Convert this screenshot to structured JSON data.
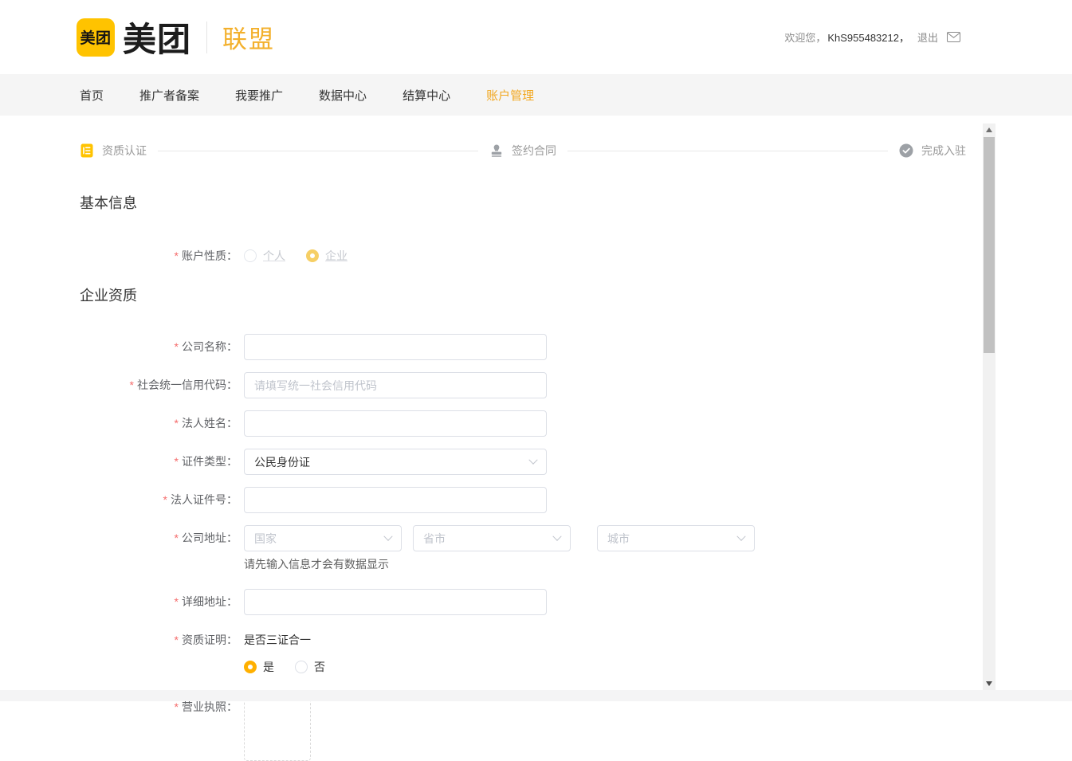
{
  "header": {
    "logo_badge": "美团",
    "logo_wordmark": "美团",
    "brand_suffix": "联盟",
    "welcome_prefix": "欢迎您，",
    "username": "KhS955483212，",
    "logout": "退出"
  },
  "nav": {
    "items": [
      {
        "label": "首页"
      },
      {
        "label": "推广者备案"
      },
      {
        "label": "我要推广"
      },
      {
        "label": "数据中心"
      },
      {
        "label": "结算中心"
      },
      {
        "label": "账户管理"
      }
    ],
    "active": "账户管理"
  },
  "stepper": {
    "steps": [
      {
        "label": "资质认证",
        "icon": "document-icon",
        "state": "current"
      },
      {
        "label": "签约合同",
        "icon": "stamp-icon",
        "state": "pending"
      },
      {
        "label": "完成入驻",
        "icon": "check-circle-icon",
        "state": "pending"
      }
    ]
  },
  "sections": {
    "basic_info": "基本信息",
    "enterprise": "企业资质"
  },
  "form": {
    "required_mark": "*",
    "account_type": {
      "label": "账户性质：",
      "option_personal": "个人",
      "option_enterprise": "企业",
      "selected": "企业",
      "disabled": true
    },
    "company_name": {
      "label": "公司名称：",
      "value": ""
    },
    "credit_code": {
      "label": "社会统一信用代码：",
      "value": "",
      "placeholder": "请填写统一社会信用代码"
    },
    "legal_name": {
      "label": "法人姓名：",
      "value": ""
    },
    "cert_type": {
      "label": "证件类型：",
      "value": "公民身份证"
    },
    "legal_cert_no": {
      "label": "法人证件号：",
      "value": ""
    },
    "company_address": {
      "label": "公司地址：",
      "country_placeholder": "国家",
      "province_placeholder": "省市",
      "city_placeholder": "城市",
      "helper": "请先输入信息才会有数据显示"
    },
    "detail_address": {
      "label": "详细地址：",
      "value": ""
    },
    "qualification": {
      "label": "资质证明：",
      "question": "是否三证合一",
      "option_yes": "是",
      "option_no": "否",
      "selected": "是"
    },
    "business_license": {
      "label": "营业执照："
    }
  },
  "colors": {
    "brand_yellow": "#ffc300",
    "accent_amber": "#f3b02c",
    "nav_active": "#f2a71f",
    "radio_selected": "#ffb000",
    "required_red": "#f56c6c"
  }
}
